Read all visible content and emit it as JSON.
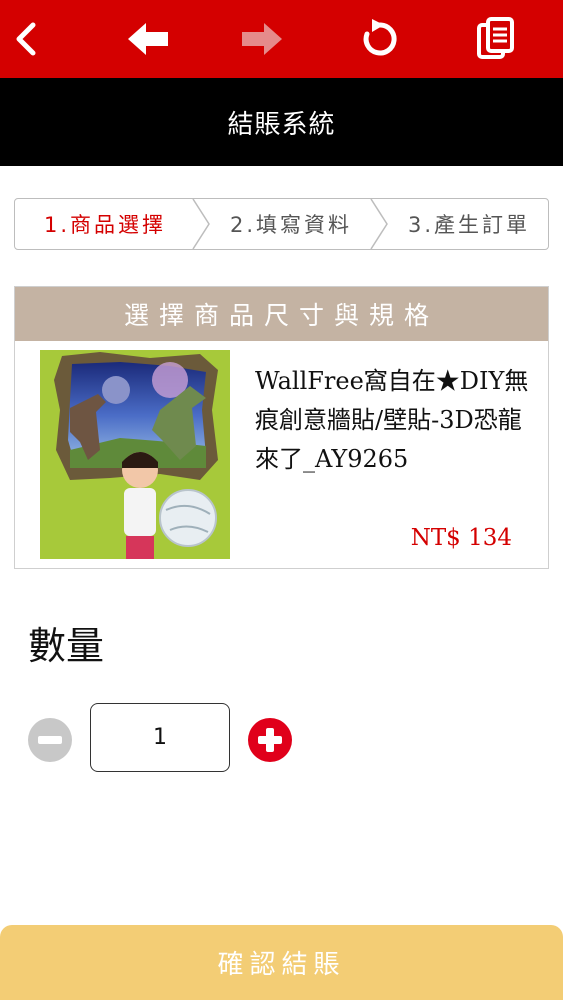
{
  "toolbar": {
    "icons": [
      "chevron-left-icon",
      "back-arrow-icon",
      "forward-arrow-icon",
      "refresh-icon",
      "documents-icon"
    ],
    "color": "#d40000"
  },
  "title": "結賬系統",
  "steps": [
    {
      "label": "1.商品選擇",
      "active": true
    },
    {
      "label": "2.填寫資料",
      "active": false
    },
    {
      "label": "3.產生訂單",
      "active": false
    }
  ],
  "product_section": {
    "header": "選擇商品尺寸與規格",
    "name": "WallFree窩自在★DIY無痕創意牆貼/壁貼-3D恐龍來了_AY9265",
    "price": "NT$ 134"
  },
  "quantity": {
    "label": "數量",
    "value": "1"
  },
  "confirm_label": "確認結賬",
  "colors": {
    "accent_red": "#d40000",
    "header_tan": "#c4b3a3",
    "confirm_yellow": "#f3cd75"
  }
}
